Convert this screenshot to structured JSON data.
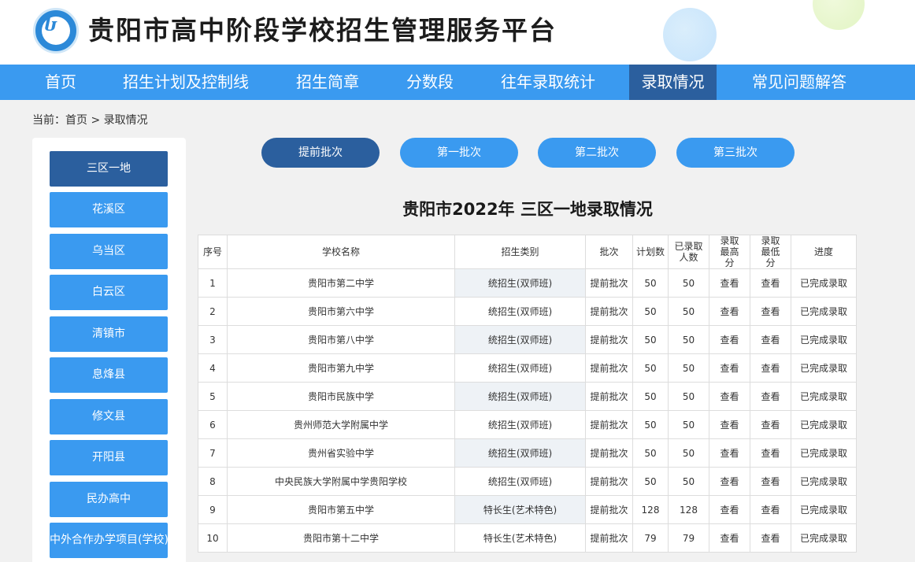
{
  "header": {
    "logo_icon": "circular-emblem-logo",
    "site_title": "贵阳市高中阶段学校招生管理服务平台"
  },
  "nav": {
    "items": [
      "首页",
      "招生计划及控制线",
      "招生简章",
      "分数段",
      "往年录取统计",
      "录取情况",
      "常见问题解答"
    ],
    "active": "录取情况"
  },
  "breadcrumb": {
    "text": "当前：首页 > 录取情况"
  },
  "sidebar": {
    "items": [
      "三区一地",
      "花溪区",
      "乌当区",
      "白云区",
      "清镇市",
      "息烽县",
      "修文县",
      "开阳县",
      "民办高中",
      "中外合作办学项目(学校)"
    ],
    "active": "三区一地"
  },
  "batches": {
    "items": [
      "提前批次",
      "第一批次",
      "第二批次",
      "第三批次"
    ],
    "active": "提前批次"
  },
  "table": {
    "title": "贵阳市2022年 三区一地录取情况",
    "headers": [
      "序号",
      "学校名称",
      "招生类别",
      "批次",
      "计划数",
      "已录取人数",
      "录取最高分",
      "录取最低分",
      "进度"
    ],
    "rows": [
      {
        "no": "1",
        "school": "贵阳市第二中学",
        "category": "统招生(双师班)",
        "batch": "提前批次",
        "plan": "50",
        "admitted": "50",
        "max": "查看",
        "min": "查看",
        "progress": "已完成录取"
      },
      {
        "no": "2",
        "school": "贵阳市第六中学",
        "category": "统招生(双师班)",
        "batch": "提前批次",
        "plan": "50",
        "admitted": "50",
        "max": "查看",
        "min": "查看",
        "progress": "已完成录取"
      },
      {
        "no": "3",
        "school": "贵阳市第八中学",
        "category": "统招生(双师班)",
        "batch": "提前批次",
        "plan": "50",
        "admitted": "50",
        "max": "查看",
        "min": "查看",
        "progress": "已完成录取"
      },
      {
        "no": "4",
        "school": "贵阳市第九中学",
        "category": "统招生(双师班)",
        "batch": "提前批次",
        "plan": "50",
        "admitted": "50",
        "max": "查看",
        "min": "查看",
        "progress": "已完成录取"
      },
      {
        "no": "5",
        "school": "贵阳市民族中学",
        "category": "统招生(双师班)",
        "batch": "提前批次",
        "plan": "50",
        "admitted": "50",
        "max": "查看",
        "min": "查看",
        "progress": "已完成录取"
      },
      {
        "no": "6",
        "school": "贵州师范大学附属中学",
        "category": "统招生(双师班)",
        "batch": "提前批次",
        "plan": "50",
        "admitted": "50",
        "max": "查看",
        "min": "查看",
        "progress": "已完成录取"
      },
      {
        "no": "7",
        "school": "贵州省实验中学",
        "category": "统招生(双师班)",
        "batch": "提前批次",
        "plan": "50",
        "admitted": "50",
        "max": "查看",
        "min": "查看",
        "progress": "已完成录取"
      },
      {
        "no": "8",
        "school": "中央民族大学附属中学贵阳学校",
        "category": "统招生(双师班)",
        "batch": "提前批次",
        "plan": "50",
        "admitted": "50",
        "max": "查看",
        "min": "查看",
        "progress": "已完成录取"
      },
      {
        "no": "9",
        "school": "贵阳市第五中学",
        "category": "特长生(艺术特色)",
        "batch": "提前批次",
        "plan": "128",
        "admitted": "128",
        "max": "查看",
        "min": "查看",
        "progress": "已完成录取"
      },
      {
        "no": "10",
        "school": "贵阳市第十二中学",
        "category": "特长生(艺术特色)",
        "batch": "提前批次",
        "plan": "79",
        "admitted": "79",
        "max": "查看",
        "min": "查看",
        "progress": "已完成录取"
      }
    ]
  },
  "colors": {
    "nav_blue": "#3a9af0",
    "active_dark_blue": "#2b5f9e",
    "link_blue": "#2c7ed4",
    "row_shade": "#eef2f6"
  }
}
